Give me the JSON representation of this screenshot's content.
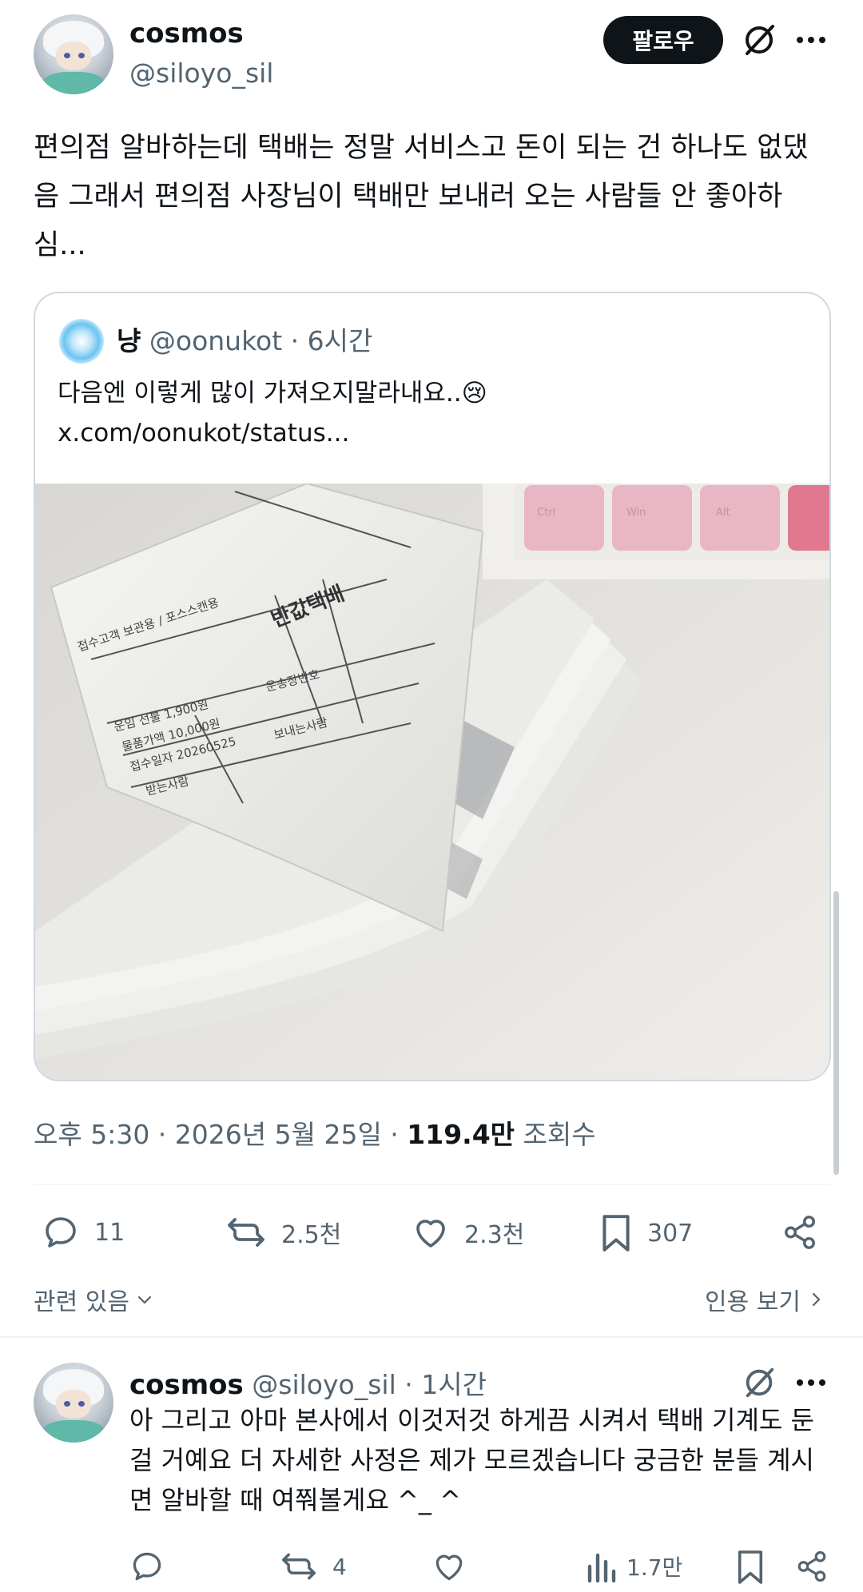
{
  "tweet": {
    "author_name": "cosmos",
    "author_handle": "@siloyo_sil",
    "follow_label": "팔로우",
    "text": "편의점 알바하는데 택배는 정말 서비스고 돈이 되는 건 하나도 없댔음 그래서 편의점 사장님이 택배만 보내러 오는 사람들 안 좋아하심...",
    "quote": {
      "author_name": "냥",
      "author_handle": "@oonukot",
      "time": "· 6시간",
      "text": "다음엔 이렇게 많이 가져오지말라내요..",
      "emoji": "😢",
      "link": "x.com/oonukot/status..."
    },
    "meta": {
      "time": "오후 5:30 · 2026년 5월 25일 · ",
      "views": "119.4만",
      "views_label": " 조회수"
    },
    "actions": {
      "replies": "11",
      "retweets": "2.5천",
      "likes": "2.3천",
      "bookmarks": "307"
    },
    "related_label": "관련 있음",
    "quotes_label": "인용 보기"
  },
  "reply": {
    "author_name": "cosmos",
    "author_handle": "@siloyo_sil",
    "time": "· 1시간",
    "text": "아 그리고 아마 본사에서 이것저것 하게끔 시켜서 택배 기계도 둔 걸 거예요 더 자세한 사정은 제가 모르겠습니다 궁금한 분들 계시면 알바할 때 여쭤볼게요 ^_ ^",
    "actions": {
      "replies": "",
      "retweets": "4",
      "likes": "",
      "views": "1.7만"
    }
  },
  "photo_labels": {
    "keycaps": [
      "Ctrl",
      "Win",
      "Alt"
    ],
    "form_title": "반값택배",
    "form_lines": [
      "접수고객 보관용 / 포스스캔용",
      "운임 선불 1,900원",
      "물품가액 10,000원",
      "접수일자 20260525",
      "받는사람",
      "보내는사람",
      "운송장번호"
    ]
  },
  "colors": {
    "text": "#0f1419",
    "secondary": "#536471",
    "border": "#cfd9de",
    "follow_bg": "#0f1419"
  },
  "icons": [
    "more-icon",
    "grok-icon",
    "reply-icon",
    "retweet-icon",
    "like-icon",
    "bookmark-icon",
    "share-icon",
    "views-icon",
    "chevron-down-icon",
    "chevron-right-icon"
  ]
}
